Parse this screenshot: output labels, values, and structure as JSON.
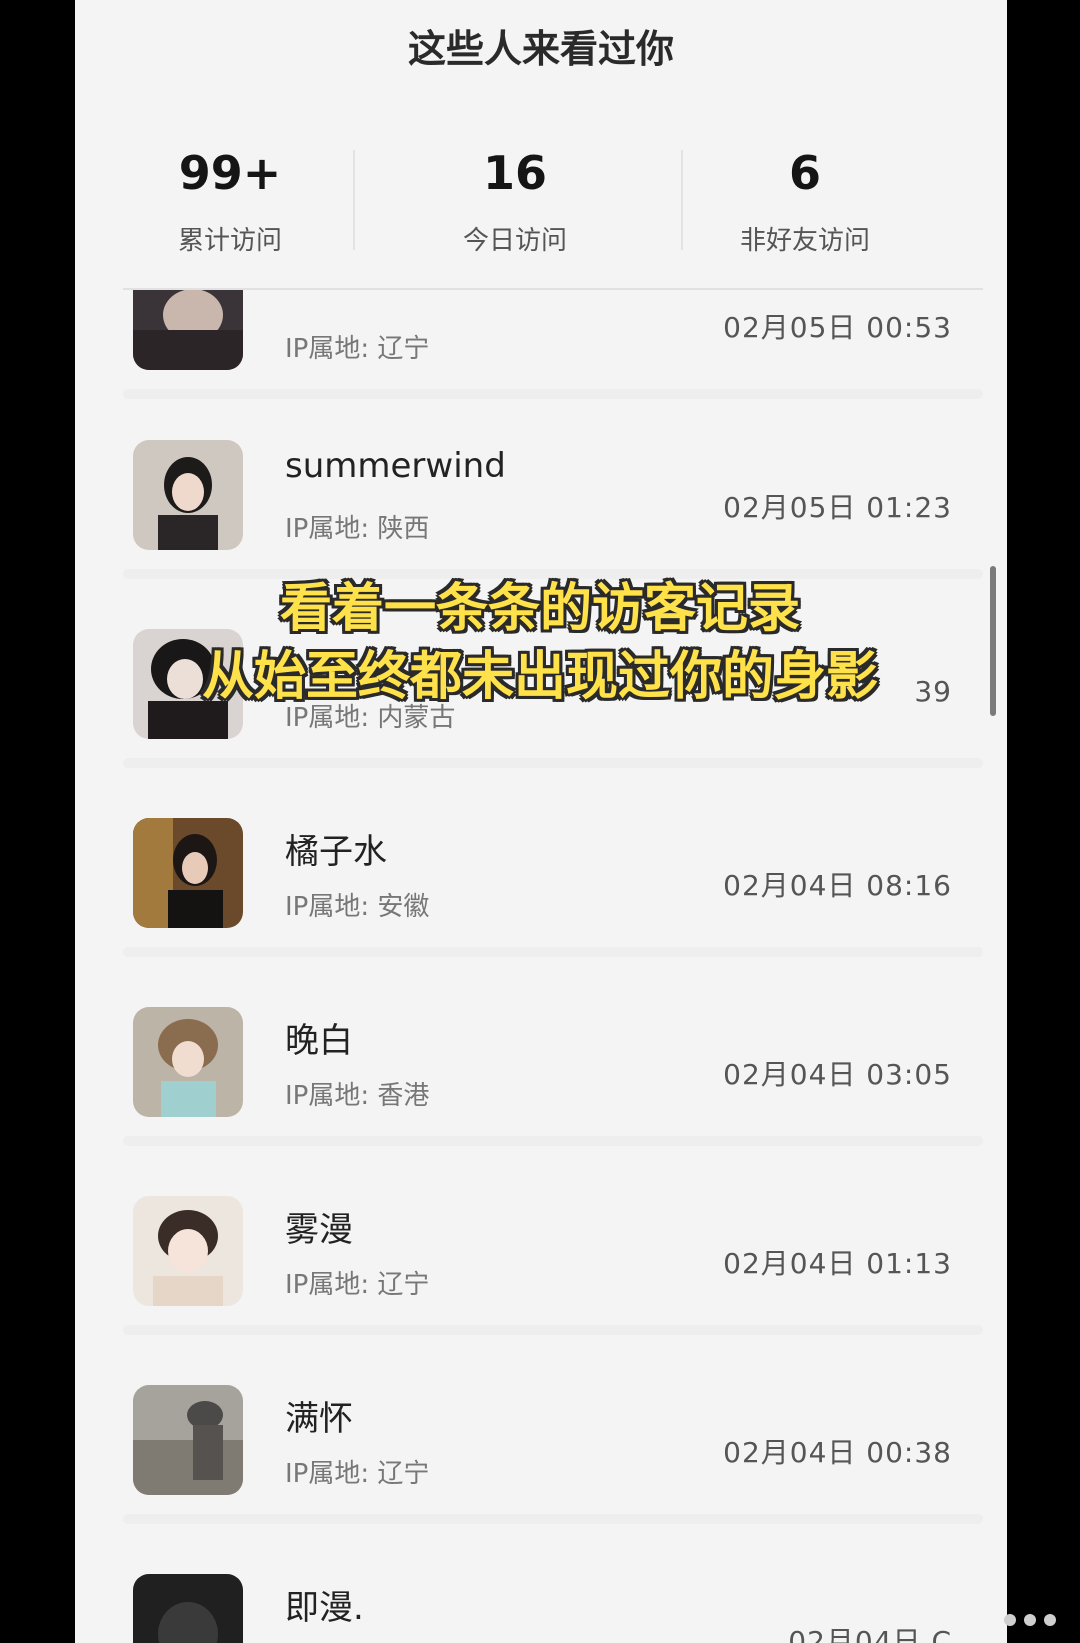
{
  "header": {
    "title": "这些人来看过你"
  },
  "stats": [
    {
      "value": "99+",
      "label": "累计访问"
    },
    {
      "value": "16",
      "label": "今日访问"
    },
    {
      "value": "6",
      "label": "非好友访问"
    }
  ],
  "visitors": [
    {
      "name": "",
      "ip": "IP属地: 辽宁",
      "time": "02月05日 00:53"
    },
    {
      "name": "summerwind",
      "ip": "IP属地: 陕西",
      "time": "02月05日 01:23"
    },
    {
      "name": "",
      "ip": "IP属地: 内蒙古",
      "time": "39"
    },
    {
      "name": "橘子水",
      "ip": "IP属地: 安徽",
      "time": "02月04日 08:16"
    },
    {
      "name": "晚白",
      "ip": "IP属地: 香港",
      "time": "02月04日 03:05"
    },
    {
      "name": "雾漫",
      "ip": "IP属地: 辽宁",
      "time": "02月04日 01:13"
    },
    {
      "name": "满怀",
      "ip": "IP属地: 辽宁",
      "time": "02月04日 00:38"
    },
    {
      "name": "即漫.",
      "ip": "",
      "time": "02月04日 C"
    }
  ],
  "overlay": {
    "line1": "看着一条条的访客记录",
    "line2": "从始至终都未出现过你的身影"
  },
  "colors": {
    "overlay_text": "#ffe14a",
    "overlay_outline": "#2a2a2a",
    "background": "#f4f4f4"
  }
}
